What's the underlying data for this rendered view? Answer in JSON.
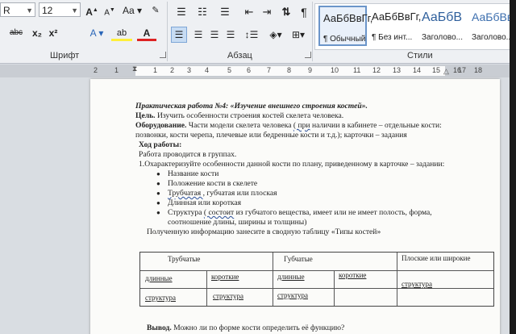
{
  "ribbon": {
    "font_name": "R",
    "font_size": "12",
    "grow_font": "A",
    "shrink_font": "A",
    "change_case": "Aa",
    "strikethrough": "abc",
    "subscript": "x₂",
    "superscript": "x²",
    "text_effects": "A",
    "highlight": "ab",
    "font_color": "A",
    "groups": {
      "font": "Шрифт",
      "paragraph": "Абзац",
      "styles": "Стили"
    },
    "styles": [
      {
        "preview": "АаБбВвГг,",
        "name": "¶ Обычный",
        "selected": true
      },
      {
        "preview": "АаБбВвГг,",
        "name": "¶ Без инт...",
        "selected": false
      },
      {
        "preview": "АаБбВ",
        "name": "Заголово...",
        "selected": false
      },
      {
        "preview": "АаБбВв",
        "name": "Заголово...",
        "selected": false
      }
    ]
  },
  "ruler": {
    "ticks": [
      "2",
      "1",
      "1",
      "2",
      "3",
      "4",
      "5",
      "6",
      "7",
      "8",
      "9",
      "10",
      "11",
      "12",
      "13",
      "14",
      "15",
      "16",
      "17",
      "18"
    ]
  },
  "document": {
    "title": "Практическая работа №4: «Изучение внешнего строения костей».",
    "goal_label": "Цель.",
    "goal_text": " Изучить особенности строения костей скелета человека.",
    "equipment_label": "Оборудование.",
    "equipment_text_1": " Части модели скелета человека ",
    "equipment_link": "( при",
    "equipment_text_2": " наличии в кабинете – отдельные кости:",
    "equipment_line2": "позвонки, кости черепа, плечевые или бедренные кости и т.д.); карточки – задания",
    "progress_heading": "Ход работы:",
    "groups_line": "Работа проводится в группах.",
    "task_1": "1.Охарактеризуйте особенности данной кости по плану, приведенному в карточке – задании:",
    "bullets": [
      {
        "pre": "",
        "marked": "",
        "post": "Название кости"
      },
      {
        "pre": "",
        "marked": "",
        "post": "Положение кости в скелете"
      },
      {
        "pre": "",
        "marked": "Трубчатая ",
        "post": ", губчатая или плоская"
      },
      {
        "pre": "",
        "marked": "",
        "post": "Длинная или короткая"
      },
      {
        "pre": "Структура ",
        "marked": "( состоит",
        "post": " из губчатого вещества, имеет или не имеет полость, форма,"
      }
    ],
    "bullet_5_line2": "соотношение длины, ширины и толщины)",
    "summary_line": "Полученную информацию занесите в сводную таблицу «Типы костей»",
    "table": {
      "headers": [
        "Трубчатые",
        "Губчатые",
        "Плоские или широкие"
      ],
      "row2": [
        "длинные",
        "короткие",
        "длинные",
        "короткие"
      ],
      "row3": [
        "структура",
        "структура",
        "структура",
        "структура"
      ]
    },
    "conclusion_label": "Вывод.",
    "conclusion_text": " Можно ли по форме кости определить её функцию?"
  }
}
